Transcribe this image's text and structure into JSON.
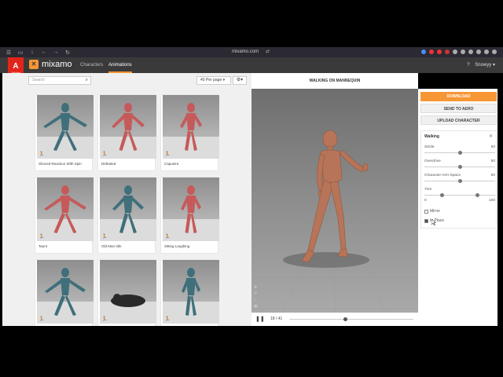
{
  "browser": {
    "url": "mixamo.com",
    "icons": [
      "menu-icon",
      "tab-icon",
      "download-icon",
      "back-icon",
      "forward-icon",
      "reload-icon"
    ],
    "extension_colors": [
      "#4a8cf7",
      "#e33",
      "#e33",
      "#c33",
      "#aaa",
      "#aaa",
      "#aaa",
      "#aaa",
      "#aaa",
      "#aaa"
    ]
  },
  "app": {
    "adobe_label": "Adobe",
    "logo_text": "mixamo",
    "tabs": [
      "Characters",
      "Animations"
    ],
    "active_tab": "Animations",
    "help": "?",
    "user": "Snowyy",
    "accent": "#f79635"
  },
  "library": {
    "search_placeholder": "Search",
    "per_page": "40 Per page",
    "cards": [
      {
        "label": "Shoved Reaction With Spin",
        "color": "teal"
      },
      {
        "label": "Defeated",
        "color": "red"
      },
      {
        "label": "Capoeira",
        "color": "red"
      },
      {
        "label": "Taunt",
        "color": "red"
      },
      {
        "label": "Old Man Idle",
        "color": "teal"
      },
      {
        "label": "Sitting Laughing",
        "color": "red"
      },
      {
        "label": "",
        "color": "teal"
      },
      {
        "label": "",
        "color": "dark"
      },
      {
        "label": "",
        "color": "teal"
      }
    ]
  },
  "viewer": {
    "title": "WALKING ON MANNEQUIN",
    "frame": "18 / 41",
    "progress": 0.45
  },
  "actions": {
    "download": "DOWNLOAD",
    "send": "SEND TO AERO",
    "upload": "UPLOAD CHARACTER"
  },
  "settings": {
    "title": "Walking",
    "params": [
      {
        "label": "Stride",
        "value": "50",
        "fraction": 0.5
      },
      {
        "label": "Overdrive",
        "value": "50",
        "fraction": 0.5
      },
      {
        "label": "Character Arm-Space",
        "value": "50",
        "fraction": 0.5
      }
    ],
    "trim": {
      "label": "Trim",
      "min": "0",
      "max": "100",
      "start": 0.25,
      "end": 0.75
    },
    "mirror": {
      "label": "Mirror",
      "checked": false
    },
    "in_place": {
      "label": "In Place",
      "checked": true
    }
  }
}
